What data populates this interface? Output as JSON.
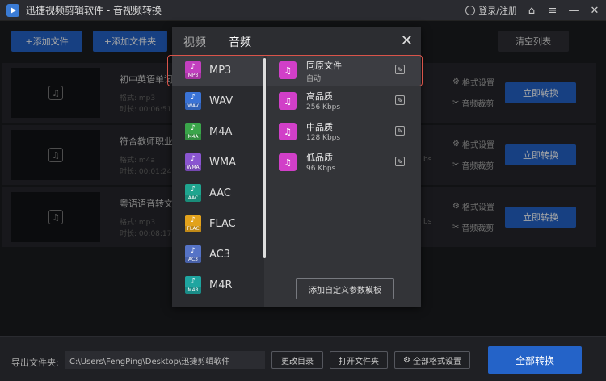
{
  "app": {
    "title": "迅捷视频剪辑软件 - 音视频转换",
    "login": "登录/注册"
  },
  "toolbar": {
    "add_file": "+添加文件",
    "add_folder": "+添加文件夹",
    "clear_list": "清空列表"
  },
  "files": [
    {
      "name": "初中英语单词",
      "format": "格式: mp3",
      "duration": "时长: 00:06:51",
      "settings": "格式设置",
      "cut": "音频裁剪",
      "convert": "立即转换"
    },
    {
      "name": "符合教师职业",
      "format": "格式: m4a",
      "duration": "时长: 00:01:24",
      "kbs": "bs",
      "settings": "格式设置",
      "cut": "音频裁剪",
      "convert": "立即转换"
    },
    {
      "name": "粤语语音转文",
      "format": "格式: mp3",
      "duration": "时长: 00:08:17",
      "kbs": "bs",
      "settings": "格式设置",
      "cut": "音频裁剪",
      "convert": "立即转换"
    }
  ],
  "bottom": {
    "output_label": "导出文件夹:",
    "output_path": "C:\\Users\\FengPing\\Desktop\\迅捷剪辑软件",
    "change_dir": "更改目录",
    "open_folder": "打开文件夹",
    "all_format": "全部格式设置",
    "convert_all": "全部转换"
  },
  "modal": {
    "tab_video": "视频",
    "tab_audio": "音频",
    "formats": [
      {
        "name": "MP3",
        "tag": "MP3",
        "color": "#c23fbf"
      },
      {
        "name": "WAV",
        "tag": "WAV",
        "color": "#3a73d6"
      },
      {
        "name": "M4A",
        "tag": "M4A",
        "color": "#3aa54a"
      },
      {
        "name": "WMA",
        "tag": "WMA",
        "color": "#8a55d0"
      },
      {
        "name": "AAC",
        "tag": "AAC",
        "color": "#1fa58f"
      },
      {
        "name": "FLAC",
        "tag": "FLAC",
        "color": "#e2a21c"
      },
      {
        "name": "AC3",
        "tag": "AC3",
        "color": "#5573c6"
      },
      {
        "name": "M4R",
        "tag": "M4R",
        "color": "#1fa5a0"
      }
    ],
    "qualities": [
      {
        "title": "同原文件",
        "sub": "自动"
      },
      {
        "title": "高品质",
        "sub": "256 Kbps"
      },
      {
        "title": "中品质",
        "sub": "128 Kbps"
      },
      {
        "title": "低品质",
        "sub": "96 Kbps"
      }
    ],
    "custom_template": "添加自定义参数模板"
  },
  "colors": {
    "accent": "#2463c8",
    "highlight": "#d9544a",
    "audio_icon": "#d13fc8"
  }
}
